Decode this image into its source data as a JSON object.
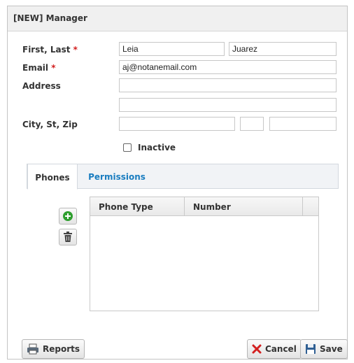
{
  "dialog": {
    "title": "[NEW] Manager"
  },
  "form": {
    "first_last_label": "First, Last",
    "email_label": "Email",
    "required_mark": "*",
    "address_label": "Address",
    "city_label": "City, St, Zip",
    "first_name": "Leia",
    "last_name": "Juarez",
    "email": "aj@notanemail.com",
    "address1": "",
    "address2": "",
    "city": "",
    "state": "",
    "zip": "",
    "inactive_label": "Inactive",
    "inactive_checked": false
  },
  "tabs": [
    {
      "label": "Phones",
      "active": true
    },
    {
      "label": "Permissions",
      "active": false
    }
  ],
  "phones_grid": {
    "columns": [
      "Phone Type",
      "Number"
    ],
    "rows": []
  },
  "footer": {
    "reports_label": "Reports",
    "cancel_label": "Cancel",
    "save_label": "Save"
  },
  "colors": {
    "required": "#d21f1f",
    "tab_link": "#1a7dc0",
    "add_icon": "#2e9e2e",
    "cancel_icon": "#d32020",
    "save_icon": "#2f5f93"
  },
  "icons": {
    "add": "add-circle-icon",
    "delete": "trash-icon",
    "reports": "printer-icon",
    "cancel": "x-icon",
    "save": "floppy-disk-icon"
  }
}
